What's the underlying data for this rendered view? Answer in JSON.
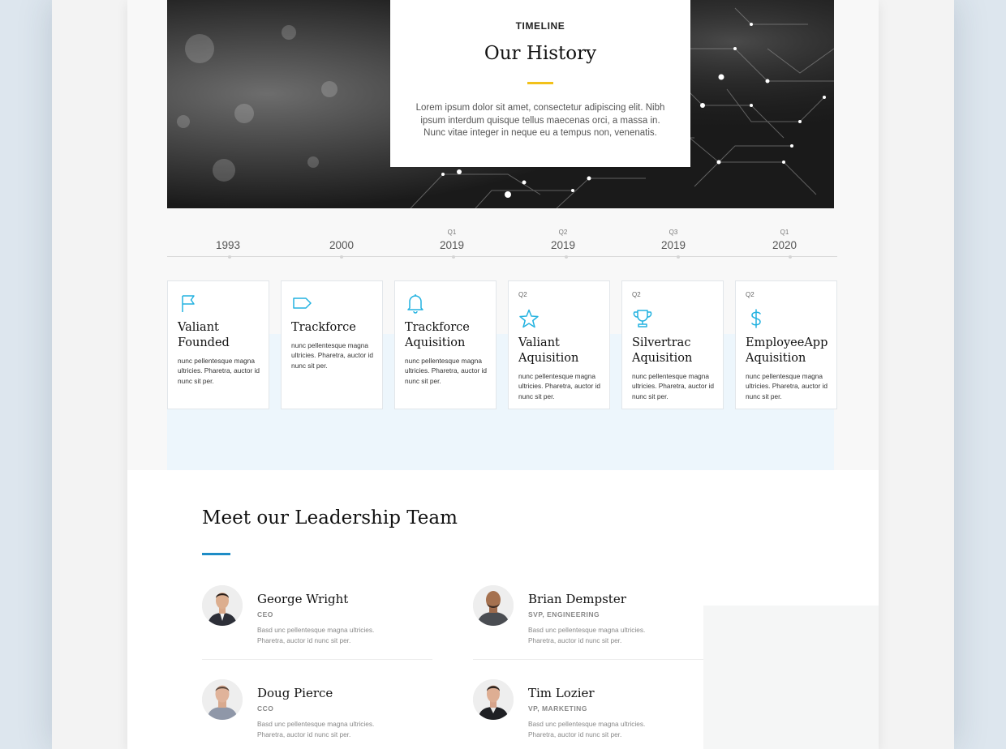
{
  "hero": {
    "eyebrow": "TIMELINE",
    "title": "Our History",
    "text": "Lorem ipsum dolor sit amet, consectetur adipiscing elit. Nibh ipsum interdum quisque tellus maecenas orci, a massa in. Nunc vitae integer in neque eu a tempus non, venenatis."
  },
  "timeline": [
    {
      "quarter": "",
      "year": "1993"
    },
    {
      "quarter": "",
      "year": "2000"
    },
    {
      "quarter": "Q1",
      "year": "2019"
    },
    {
      "quarter": "Q2",
      "year": "2019"
    },
    {
      "quarter": "Q3",
      "year": "2019"
    },
    {
      "quarter": "Q1",
      "year": "2020"
    }
  ],
  "events": [
    {
      "quarter": "",
      "icon": "flag-icon",
      "title": "Valiant Founded",
      "text": "nunc pellentesque magna ultricies. Pharetra, auctor id nunc sit per."
    },
    {
      "quarter": "",
      "icon": "tag-icon",
      "title": "Trackforce",
      "text": "nunc pellentesque magna ultricies. Pharetra, auctor id nunc sit per."
    },
    {
      "quarter": "",
      "icon": "bell-icon",
      "title": "Trackforce Aquisition",
      "text": "nunc pellentesque magna ultricies. Pharetra, auctor id nunc sit per."
    },
    {
      "quarter": "Q2",
      "icon": "star-icon",
      "title": "Valiant Aquisition",
      "text": "nunc pellentesque magna ultricies. Pharetra, auctor id nunc sit per."
    },
    {
      "quarter": "Q2",
      "icon": "trophy-icon",
      "title": "Silvertrac Aquisition",
      "text": "nunc pellentesque magna ultricies. Pharetra, auctor id nunc sit per."
    },
    {
      "quarter": "Q2",
      "icon": "dollar-icon",
      "title": "EmployeeApp Aquisition",
      "text": "nunc pellentesque magna ultricies. Pharetra, auctor id nunc sit per."
    }
  ],
  "leadership": {
    "title": "Meet our Leadership Team",
    "members": [
      {
        "name": "George Wright",
        "role": "CEO",
        "desc": "Basd unc pellentesque magna ultricies. Pharetra, auctor id nunc sit per."
      },
      {
        "name": "Brian Dempster",
        "role": "SVP, ENGINEERING",
        "desc": "Basd unc pellentesque magna ultricies. Pharetra, auctor id nunc sit per."
      },
      {
        "name": "Doug Pierce",
        "role": "CCO",
        "desc": "Basd unc pellentesque magna ultricies. Pharetra, auctor id nunc sit per."
      },
      {
        "name": "Tim Lozier",
        "role": "VP, MARKETING",
        "desc": "Basd unc pellentesque magna ultricies. Pharetra, auctor id nunc sit per."
      }
    ]
  },
  "colors": {
    "accent_gold": "#f2c11a",
    "accent_blue": "#1e8cc6",
    "icon_cyan": "#23b2e0",
    "band_blue": "#edf6fc"
  }
}
